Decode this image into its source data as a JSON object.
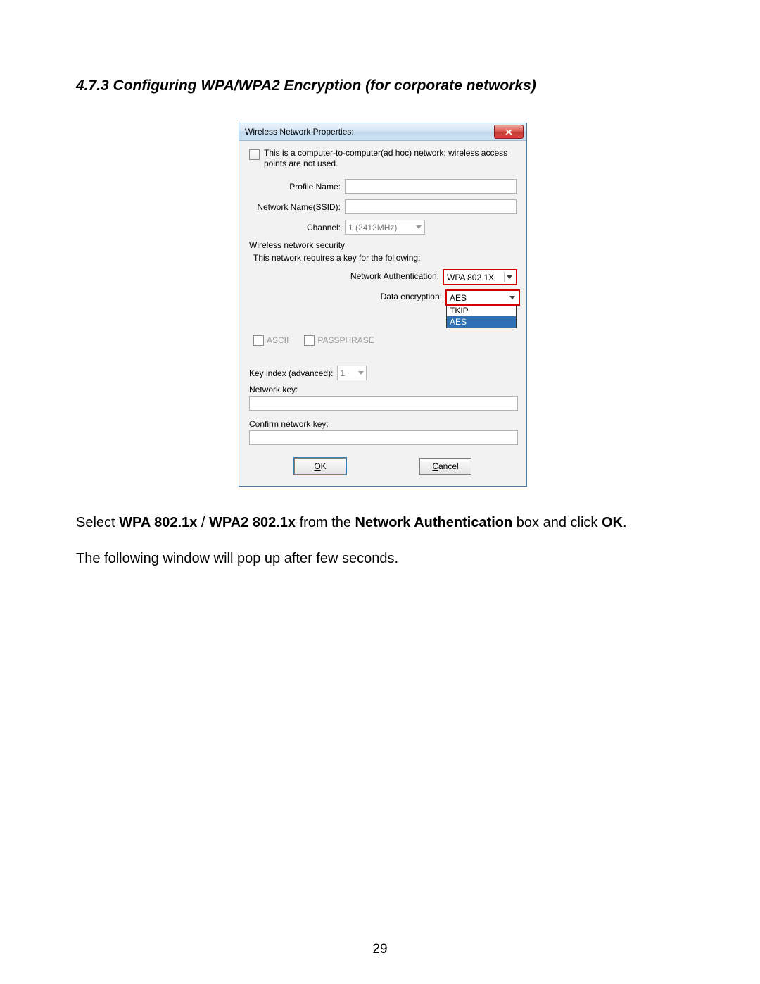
{
  "heading": "4.7.3 Configuring WPA/WPA2 Encryption (for corporate networks)",
  "dialog": {
    "title": "Wireless Network Properties:",
    "adhoc_text": "This is a computer-to-computer(ad hoc) network; wireless access points are not used.",
    "profile_label": "Profile Name:",
    "ssid_label": "Network Name(SSID):",
    "channel_label": "Channel:",
    "channel_value": "1 (2412MHz)",
    "security_title": "Wireless network security",
    "security_sub": "This network requires a key for the following:",
    "auth_label": "Network Authentication:",
    "auth_value": "WPA 802.1X",
    "enc_label": "Data encryption:",
    "enc_value": "AES",
    "enc_options": {
      "opt1": "TKIP",
      "opt2": "AES"
    },
    "ascii_label": "ASCII",
    "pass_label": "PASSPHRASE",
    "keyidx_label": "Key index (advanced):",
    "keyidx_value": "1",
    "netkey_label": "Network key:",
    "confirm_label": "Confirm network key:",
    "ok_u": "O",
    "ok_rest": "K",
    "cancel_u": "C",
    "cancel_rest": "ancel"
  },
  "para1_a": "Select ",
  "para1_b": "WPA 802.1x",
  "para1_c": " / ",
  "para1_d": "WPA2 802.1x",
  "para1_e": " from the ",
  "para1_f": "Network Authentication",
  "para1_g": " box and click ",
  "para1_h": "OK",
  "para1_i": ".",
  "para2": "The following window will pop up after few seconds.",
  "page_number": "29"
}
